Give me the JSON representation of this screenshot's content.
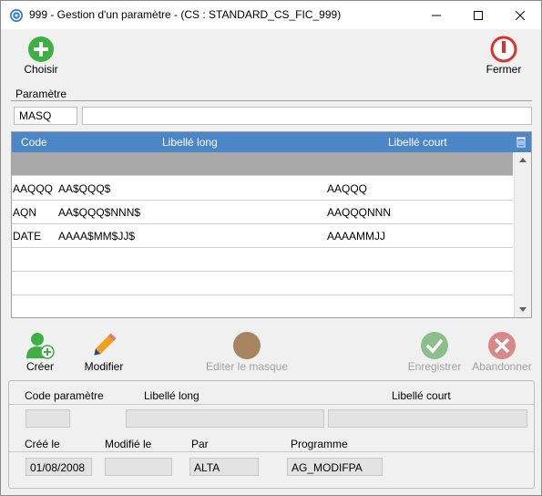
{
  "window": {
    "title": "999 - Gestion d'un paramètre - (CS : STANDARD_CS_FIC_999)"
  },
  "toolbar": {
    "choose_label": "Choisir",
    "close_label": "Fermer"
  },
  "parametre": {
    "section_label": "Paramètre",
    "code_value": "MASQ",
    "label_value": ""
  },
  "grid": {
    "columns": [
      "Code",
      "Libellé long",
      "Libellé court"
    ],
    "rows": [
      {
        "code": "",
        "long": "",
        "short": ""
      },
      {
        "code": "AAQQQ",
        "long": "AA$QQQ$",
        "short": "AAQQQ"
      },
      {
        "code": "AQN",
        "long": "AA$QQQ$NNN$",
        "short": "AAQQQNNN"
      },
      {
        "code": "DATE",
        "long": "AAAA$MM$JJ$",
        "short": "AAAAMMJJ"
      },
      {
        "code": "",
        "long": "",
        "short": ""
      },
      {
        "code": "",
        "long": "",
        "short": ""
      },
      {
        "code": "",
        "long": "",
        "short": ""
      }
    ]
  },
  "actions": {
    "create_label": "Créer",
    "modify_label": "Modifier",
    "edit_mask_label": "Editer le masque",
    "save_label": "Enregistrer",
    "cancel_label": "Abandonner"
  },
  "detail": {
    "code_label": "Code paramètre",
    "long_label": "Libellé long",
    "short_label": "Libellé court",
    "code_value": "",
    "long_value": "",
    "short_value": "",
    "created_label": "Créé le",
    "modified_label": "Modifié le",
    "by_label": "Par",
    "program_label": "Programme",
    "created_value": "01/08/2008",
    "modified_value": "",
    "by_value": "ALTA",
    "program_value": "AG_MODIFPA"
  },
  "colors": {
    "grid_header": "#4a86c8",
    "selected_row": "#a8a8a8",
    "add_green": "#3cb043",
    "close_red": "#d9342b"
  }
}
